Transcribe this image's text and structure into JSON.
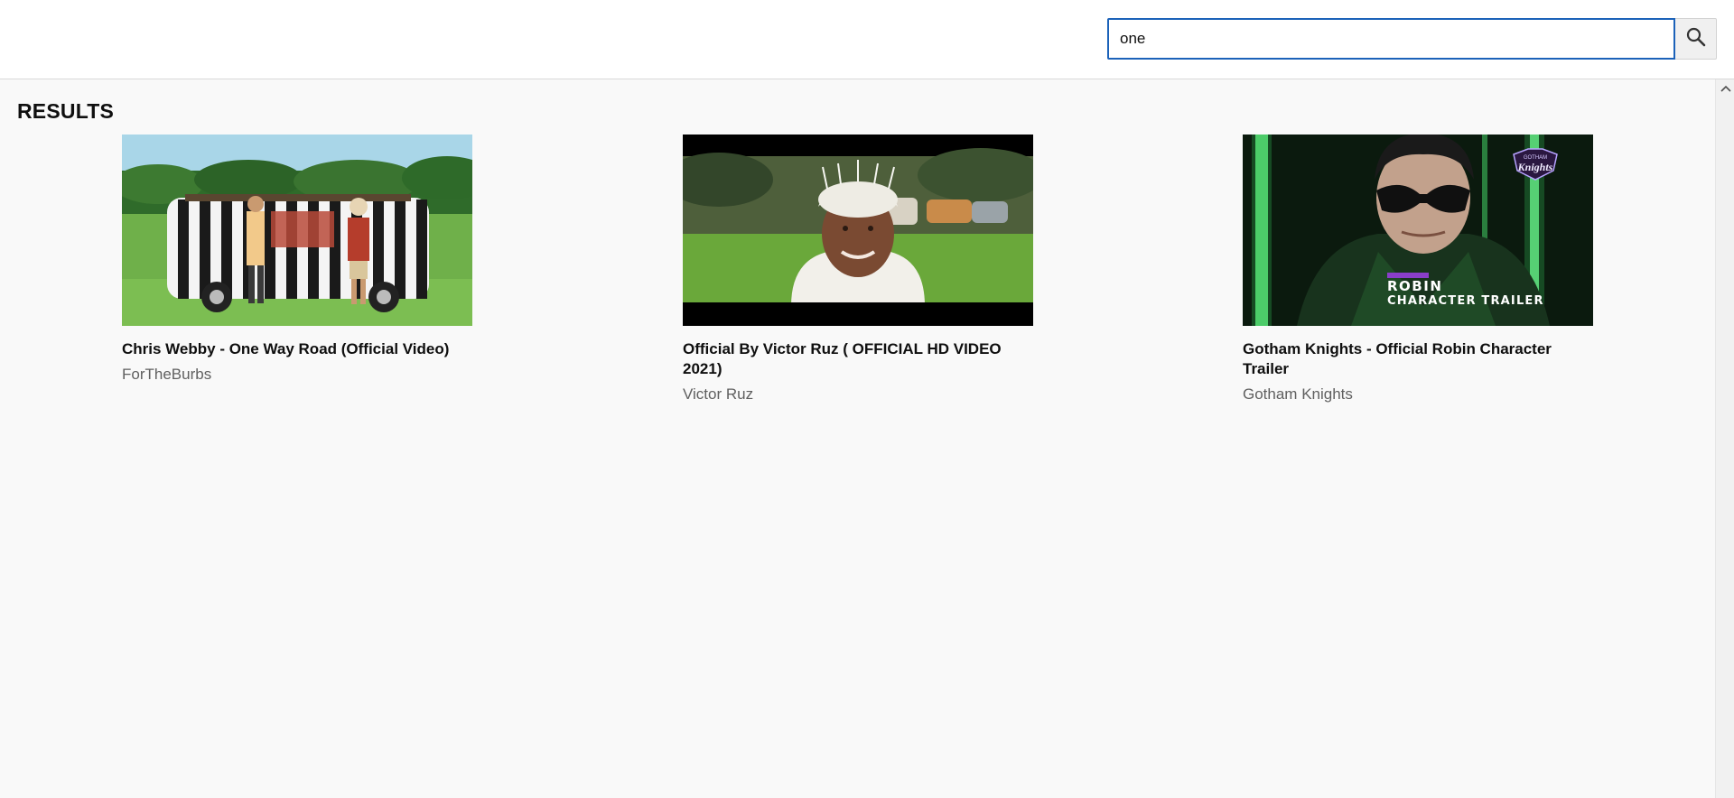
{
  "search": {
    "value": "one",
    "placeholder": "Search"
  },
  "icons": {
    "search": "search-icon",
    "scroll_up": "chevron-up-icon"
  },
  "results": {
    "heading": "RESULTS",
    "items": [
      {
        "title": "Chris Webby - One Way Road (Official Video)",
        "channel": "ForTheBurbs"
      },
      {
        "title": "Official By Victor Ruz ( OFFICIAL HD VIDEO 2021)",
        "channel": "Victor Ruz"
      },
      {
        "title": "Gotham Knights - Official Robin Character Trailer",
        "channel": "Gotham Knights",
        "thumb_text": {
          "logo_top": "GOTHAM",
          "logo_bottom": "Knights",
          "line1": "ROBIN",
          "line2": "CHARACTER TRAILER"
        }
      }
    ]
  },
  "colors": {
    "accent": "#1c62b9",
    "title": "#0f0f0f",
    "channel": "#606060",
    "background": "#f9f9f9"
  }
}
